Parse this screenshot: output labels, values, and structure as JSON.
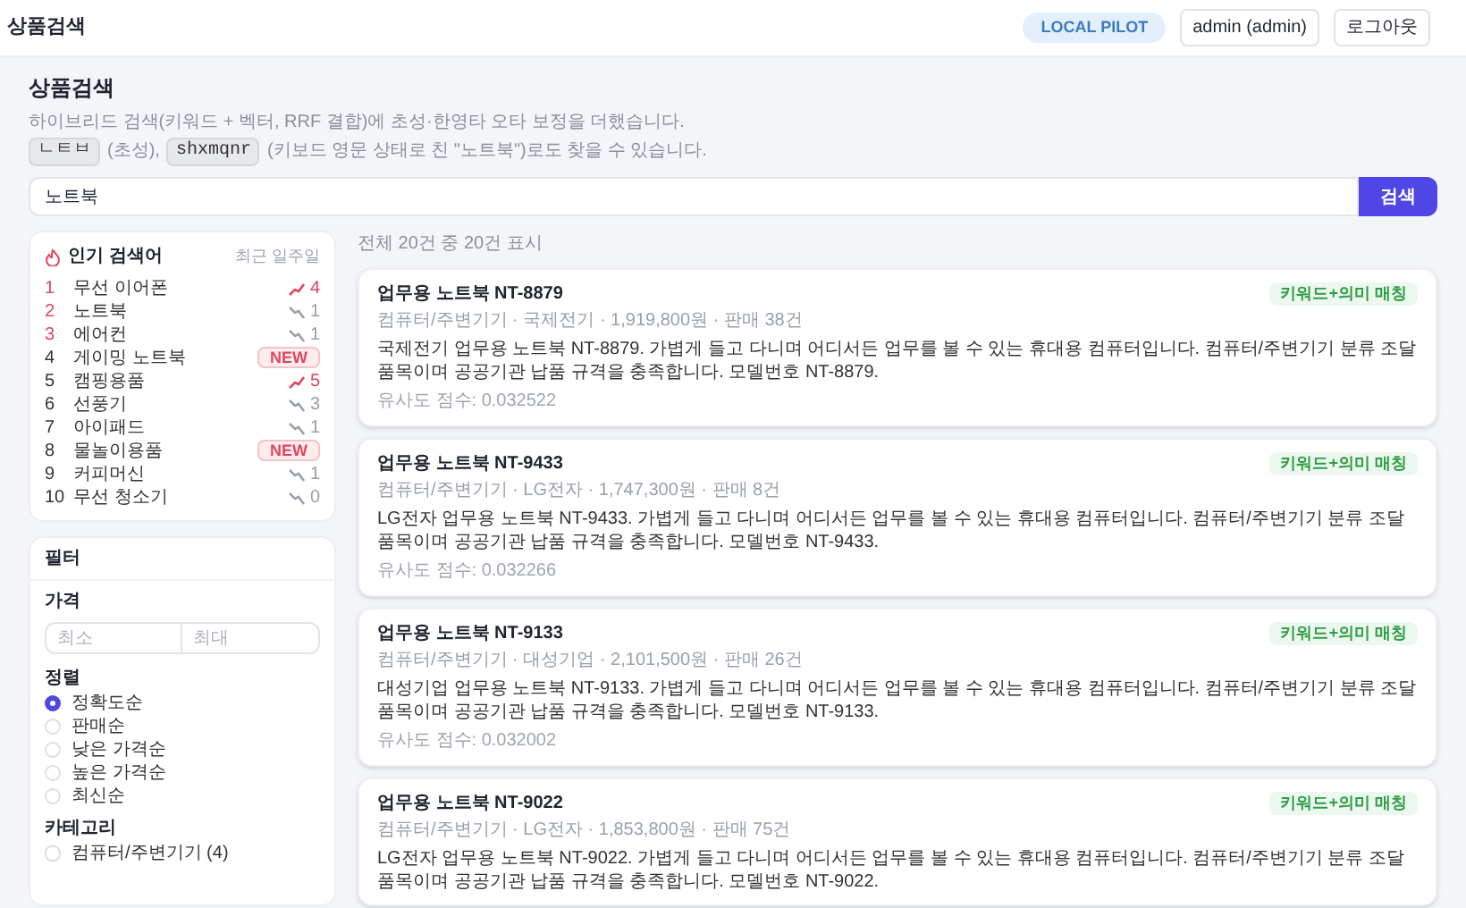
{
  "header": {
    "title": "상품검색",
    "env_badge": "LOCAL PILOT",
    "user": "admin (admin)",
    "logout": "로그아웃"
  },
  "page": {
    "title": "상품검색",
    "description": "하이브리드 검색(키워드 + 벡터, RRF 결합)에 초성·한영타 오타 보정을 더했습니다.",
    "hint": [
      {
        "kind": "kbd",
        "text": "ㄴㅌㅂ"
      },
      {
        "kind": "text",
        "text": "(초성),"
      },
      {
        "kind": "kbd",
        "text": "shxmqnr"
      },
      {
        "kind": "text",
        "text": "(키보드 영문 상태로 친 \"노트북\")로도 찾을 수 있습니다."
      }
    ]
  },
  "search": {
    "value": "노트북",
    "button": "검색"
  },
  "popular": {
    "title": "인기 검색어",
    "period": "최근 일주일",
    "items": [
      {
        "rank": "1",
        "term": "무선 이어폰",
        "kind": "up",
        "change": "4"
      },
      {
        "rank": "2",
        "term": "노트북",
        "kind": "down",
        "change": "1"
      },
      {
        "rank": "3",
        "term": "에어컨",
        "kind": "down",
        "change": "1"
      },
      {
        "rank": "4",
        "term": "게이밍 노트북",
        "kind": "new",
        "change": "NEW"
      },
      {
        "rank": "5",
        "term": "캠핑용품",
        "kind": "up",
        "change": "5"
      },
      {
        "rank": "6",
        "term": "선풍기",
        "kind": "down",
        "change": "3"
      },
      {
        "rank": "7",
        "term": "아이패드",
        "kind": "down",
        "change": "1"
      },
      {
        "rank": "8",
        "term": "물놀이용품",
        "kind": "new",
        "change": "NEW"
      },
      {
        "rank": "9",
        "term": "커피머신",
        "kind": "down",
        "change": "1"
      },
      {
        "rank": "10",
        "term": "무선 청소기",
        "kind": "down",
        "change": "0"
      }
    ]
  },
  "filter": {
    "title": "필터",
    "price_label": "가격",
    "min_placeholder": "최소",
    "max_placeholder": "최대",
    "sort_label": "정렬",
    "sort_options": [
      {
        "label": "정확도순",
        "selected": true
      },
      {
        "label": "판매순",
        "selected": false
      },
      {
        "label": "낮은 가격순",
        "selected": false
      },
      {
        "label": "높은 가격순",
        "selected": false
      },
      {
        "label": "최신순",
        "selected": false
      }
    ],
    "category_label": "카테고리",
    "categories": [
      {
        "label": "컴퓨터/주변기기 (4)",
        "checked": false
      }
    ]
  },
  "results": {
    "summary": "전체 20건 중 20건 표시",
    "items": [
      {
        "title": "업무용 노트북 NT-8879",
        "badge": "키워드+의미 매칭",
        "meta": "컴퓨터/주변기기 · 국제전기 · 1,919,800원 · 판매 38건",
        "description": "국제전기 업무용 노트북 NT-8879. 가볍게 들고 다니며 어디서든 업무를 볼 수 있는 휴대용 컴퓨터입니다. 컴퓨터/주변기기 분류 조달 품목이며 공공기관 납품 규격을 충족합니다. 모델번호 NT-8879.",
        "score": "유사도 점수: 0.032522"
      },
      {
        "title": "업무용 노트북 NT-9433",
        "badge": "키워드+의미 매칭",
        "meta": "컴퓨터/주변기기 · LG전자 · 1,747,300원 · 판매 8건",
        "description": "LG전자 업무용 노트북 NT-9433. 가볍게 들고 다니며 어디서든 업무를 볼 수 있는 휴대용 컴퓨터입니다. 컴퓨터/주변기기 분류 조달 품목이며 공공기관 납품 규격을 충족합니다. 모델번호 NT-9433.",
        "score": "유사도 점수: 0.032266"
      },
      {
        "title": "업무용 노트북 NT-9133",
        "badge": "키워드+의미 매칭",
        "meta": "컴퓨터/주변기기 · 대성기업 · 2,101,500원 · 판매 26건",
        "description": "대성기업 업무용 노트북 NT-9133. 가볍게 들고 다니며 어디서든 업무를 볼 수 있는 휴대용 컴퓨터입니다. 컴퓨터/주변기기 분류 조달 품목이며 공공기관 납품 규격을 충족합니다. 모델번호 NT-9133.",
        "score": "유사도 점수: 0.032002"
      },
      {
        "title": "업무용 노트북 NT-9022",
        "badge": "키워드+의미 매칭",
        "meta": "컴퓨터/주변기기 · LG전자 · 1,853,800원 · 판매 75건",
        "description": "LG전자 업무용 노트북 NT-9022. 가볍게 들고 다니며 어디서든 업무를 볼 수 있는 휴대용 컴퓨터입니다. 컴퓨터/주변기기 분류 조달 품목이며 공공기관 납품 규격을 충족합니다. 모델번호 NT-9022."
      }
    ]
  }
}
